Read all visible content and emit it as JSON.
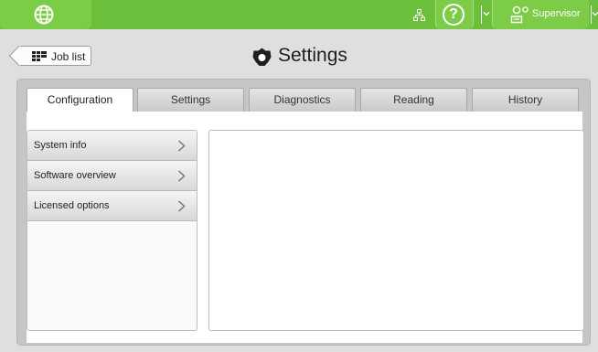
{
  "topbar": {
    "globe_icon": "globe-icon",
    "network_icon": "network-icon",
    "help_symbol": "?",
    "user_label": "Supervisor",
    "accent_color": "#7ccc47"
  },
  "header": {
    "back_button_label": "Job list",
    "title": "Settings"
  },
  "tabs": [
    {
      "label": "Configuration",
      "active": true
    },
    {
      "label": "Settings",
      "active": false
    },
    {
      "label": "Diagnostics",
      "active": false
    },
    {
      "label": "Reading",
      "active": false
    },
    {
      "label": "History",
      "active": false
    }
  ],
  "menu": {
    "items": [
      {
        "label": "System info"
      },
      {
        "label": "Software overview"
      },
      {
        "label": "Licensed options"
      }
    ]
  }
}
